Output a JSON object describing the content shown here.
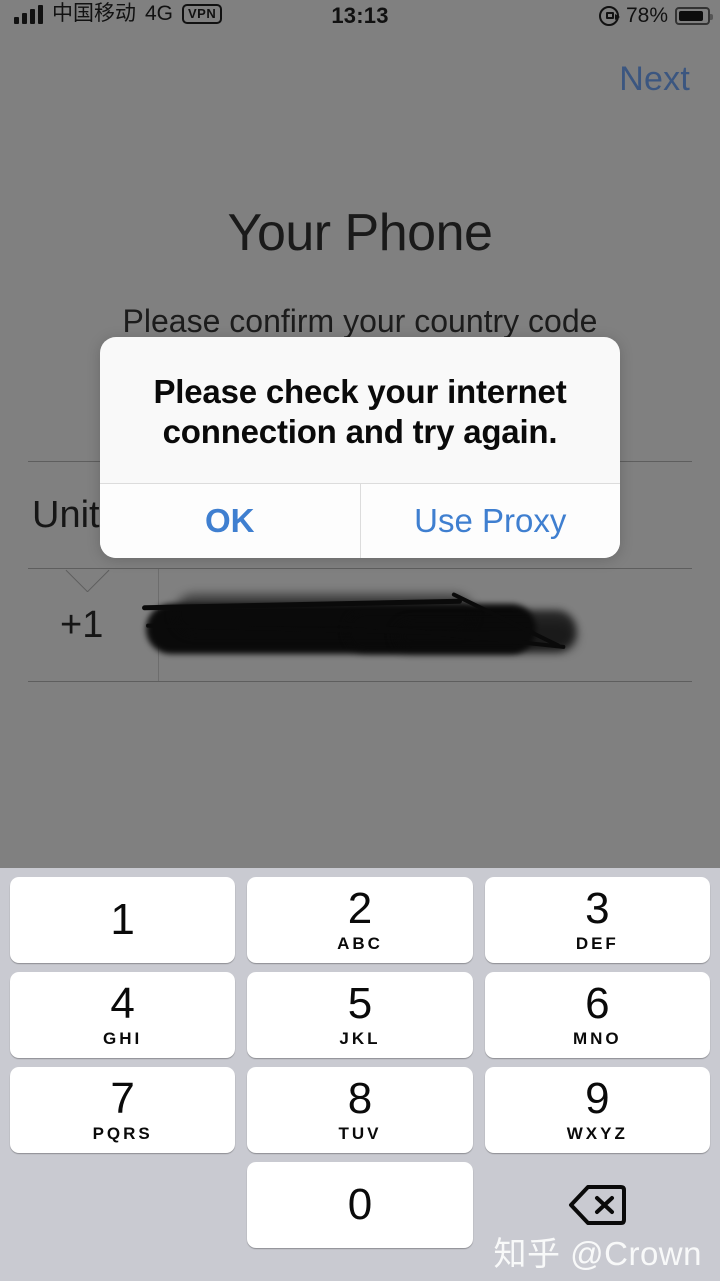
{
  "status_bar": {
    "carrier": "中国移动",
    "network": "4G",
    "vpn_badge": "VPN",
    "time": "13:13",
    "battery_percent": "78%",
    "battery_level": 78,
    "signal_bars": 4,
    "icons": [
      "signal-bars-icon",
      "vpn-badge",
      "rotation-lock-icon",
      "battery-icon"
    ]
  },
  "nav": {
    "next_label": "Next"
  },
  "page": {
    "title": "Your Phone",
    "subtitle": "Please confirm your country code",
    "country_name": "United States",
    "country_name_visible": "Unit",
    "dial_code": "+1",
    "phone_number_value": "",
    "phone_number_redacted": true
  },
  "alert": {
    "title": "Please check your internet connection and try again.",
    "buttons": [
      {
        "label": "OK",
        "style": "primary"
      },
      {
        "label": "Use Proxy",
        "style": "default"
      }
    ]
  },
  "keyboard": {
    "type": "numeric-pad",
    "keys": [
      {
        "num": "1",
        "letters": ""
      },
      {
        "num": "2",
        "letters": "ABC"
      },
      {
        "num": "3",
        "letters": "DEF"
      },
      {
        "num": "4",
        "letters": "GHI"
      },
      {
        "num": "5",
        "letters": "JKL"
      },
      {
        "num": "6",
        "letters": "MNO"
      },
      {
        "num": "7",
        "letters": "PQRS"
      },
      {
        "num": "8",
        "letters": "TUV"
      },
      {
        "num": "9",
        "letters": "WXYZ"
      },
      {
        "num": "0",
        "letters": ""
      }
    ],
    "delete_key": "backspace-icon"
  },
  "watermark": "知乎 @Crown",
  "colors": {
    "overlay_dim": "#808080",
    "accent_blue": "#3f7fd0",
    "next_blue_dimmed": "#3b5680",
    "keyboard_bg": "#c9cad1",
    "key_bg": "#ffffff",
    "alert_bg": "#f9f9f9"
  }
}
